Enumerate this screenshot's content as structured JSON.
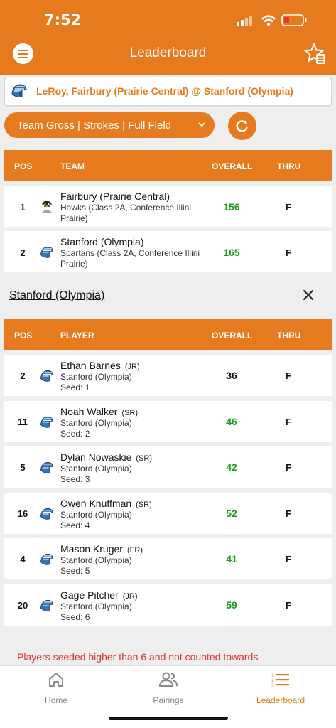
{
  "status": {
    "time": "7:52"
  },
  "header": {
    "title": "Leaderboard"
  },
  "matchup": {
    "text": "LeRoy, Fairbury (Prairie Central) @ Stanford (Olympia)"
  },
  "filter": {
    "label": "Team Gross | Strokes | Full Field"
  },
  "team_table": {
    "headers": {
      "pos": "POS",
      "team": "TEAM",
      "overall": "OVERALL",
      "thru": "THRU"
    },
    "rows": [
      {
        "pos": "1",
        "name": "Fairbury (Prairie Central)",
        "sub1": "Hawks (Class 2A, Conference Illini",
        "sub2": "Prairie)",
        "overall": "156",
        "thru": "F",
        "logo": "hawk-logo"
      },
      {
        "pos": "2",
        "name": "Stanford (Olympia)",
        "sub1": "Spartans (Class 2A, Conference Illini",
        "sub2": "Prairie)",
        "overall": "165",
        "thru": "F",
        "logo": "spartan-logo"
      }
    ]
  },
  "selected_team": {
    "name": "Stanford (Olympia)"
  },
  "player_table": {
    "headers": {
      "pos": "POS",
      "player": "PLAYER",
      "overall": "OVERALL",
      "thru": "THRU"
    },
    "rows": [
      {
        "pos": "2",
        "name": "Ethan Barnes",
        "grade": "(JR)",
        "school": "Stanford (Olympia)",
        "seed": "Seed: 1",
        "overall": "36",
        "thru": "F",
        "color": "black"
      },
      {
        "pos": "11",
        "name": "Noah Walker",
        "grade": "(SR)",
        "school": "Stanford (Olympia)",
        "seed": "Seed: 2",
        "overall": "46",
        "thru": "F",
        "color": "green"
      },
      {
        "pos": "5",
        "name": "Dylan Nowaskie",
        "grade": "(SR)",
        "school": "Stanford (Olympia)",
        "seed": "Seed: 3",
        "overall": "42",
        "thru": "F",
        "color": "green"
      },
      {
        "pos": "16",
        "name": "Owen Knuffman",
        "grade": "(SR)",
        "school": "Stanford (Olympia)",
        "seed": "Seed: 4",
        "overall": "52",
        "thru": "F",
        "color": "green"
      },
      {
        "pos": "4",
        "name": "Mason Kruger",
        "grade": "(FR)",
        "school": "Stanford (Olympia)",
        "seed": "Seed: 5",
        "overall": "41",
        "thru": "F",
        "color": "green"
      },
      {
        "pos": "20",
        "name": "Gage Pitcher",
        "grade": "(JR)",
        "school": "Stanford (Olympia)",
        "seed": "Seed: 6",
        "overall": "59",
        "thru": "F",
        "color": "green"
      }
    ]
  },
  "note": "Players seeded higher than 6 and not counted towards",
  "tabs": [
    {
      "label": "Home",
      "icon": "home-icon"
    },
    {
      "label": "Pairings",
      "icon": "people-icon"
    },
    {
      "label": "Leaderboard",
      "icon": "list-icon"
    }
  ],
  "colors": {
    "accent": "#e57b1e",
    "green": "#1f9a1f",
    "note_red": "#d9322e"
  }
}
